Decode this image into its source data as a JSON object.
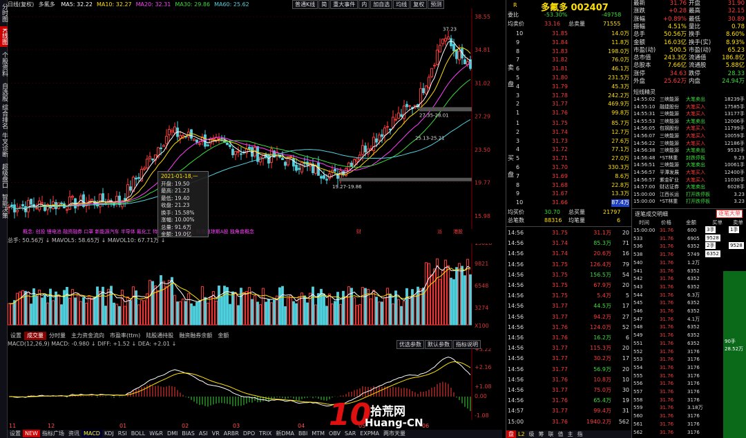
{
  "sidebar": [
    "分时图",
    "K线图",
    "个股资料",
    "自选股",
    "综合排名",
    "牛叉诊断",
    "超级盘口",
    "智能决策"
  ],
  "header": {
    "period": "日线(复权)",
    "stock_name": "多氟多",
    "ma": [
      {
        "label": "MA5: 32.22",
        "color": "#ffffff"
      },
      {
        "label": "MA10: 32.27",
        "color": "#ffe000"
      },
      {
        "label": "MA20: 32.31",
        "color": "#ff40ff"
      },
      {
        "label": "MA30: 29.86",
        "color": "#3cdc3c"
      },
      {
        "label": "MA60: 25.62",
        "color": "#4fd3e0"
      }
    ],
    "right_tools": [
      "普通K线",
      "简",
      "重大事件",
      "内",
      "加自选",
      "均线",
      "复权",
      "预测"
    ]
  },
  "price_axis": [
    "38.55",
    "34.81",
    "31.02",
    "27.29",
    "23.50",
    "19.77",
    "15.98"
  ],
  "annotations": {
    "high": "37.23",
    "range1": "27.35-28.01",
    "range2": "25.13-25.21",
    "low": "19.27-19.86"
  },
  "tooltip": {
    "date": "2021-01-18,一",
    "rows": [
      "开盘: 19.50",
      "最高: 21.23",
      "最低: 19.40",
      "收盘: 21.23",
      "换手: 15.58%",
      "涨幅: 10.00%",
      "总量: 91.6万",
      "金额: 19.0亿"
    ]
  },
  "concept_bar": "概念: 创投  锂电池  融资融券  口罩  新能源汽车  半导体  氟化工  特高压  稀土  氟化工  标普道琼斯A股  独角兽概念",
  "concept_marks": [
    "财",
    "派",
    "港股"
  ],
  "volume": {
    "legend": "总手: 50.56万 ↓  MAVOL5: 58.65万 ↓  MAVOL10: 67.71万 ↓",
    "axis": [
      "13028",
      "9821",
      "6548",
      "3274",
      "X100"
    ],
    "tabs": [
      "设置",
      "成交量",
      "分时量",
      "主力资金流向",
      "市盈率(ttm)",
      "陆股通持股",
      "融资融券余额",
      "金额"
    ],
    "active_tab": 1
  },
  "macd": {
    "legend": "MACD(12,26,9)  MACD: -0.980 ↓  DIFF: +1.52 ↓  DEA: +2.01 ↓",
    "buttons": [
      "优选参数",
      "默认参数",
      "指标说明"
    ],
    "axis": [
      "+3.22",
      "+2.16",
      "+1.08",
      "0.00",
      "-1.08"
    ]
  },
  "x_axis": [
    "11",
    "12",
    "01",
    "02",
    "03",
    "04",
    "05",
    "06"
  ],
  "bottom_tabs": [
    "设置",
    "NEW",
    "指标广场",
    "资讯",
    "MACD",
    "KDJ",
    "RSI",
    "BOLL",
    "W&R",
    "DMI",
    "BIAS",
    "ASI",
    "VR",
    "ARBR",
    "DPO",
    "TRIX",
    "新DMA",
    "BBI",
    "MTM",
    "OBV",
    "SAR",
    "EXPMA",
    "两市天量"
  ],
  "quote": {
    "tag": "R",
    "title": "多氟多 002407",
    "weibi_label": "委比",
    "weibi": "-53.30%",
    "weicha": "-49758",
    "avg_label": "均卖价",
    "avg_sell": "33.16",
    "total_sell_label": "总卖量",
    "total_sell": "71555",
    "sell_side": "卖盘",
    "buy_side": "买盘",
    "asks": [
      [
        "10",
        "31.85",
        "14.0万"
      ],
      [
        "9",
        "31.84",
        "11.8万"
      ],
      [
        "8",
        "31.83",
        "198.0万"
      ],
      [
        "7",
        "31.82",
        "76.0万"
      ],
      [
        "6",
        "31.81",
        "46.1万"
      ],
      [
        "5",
        "31.80",
        "231.5万"
      ],
      [
        "4",
        "31.79",
        "45.3万"
      ],
      [
        "3",
        "31.78",
        "242.2万"
      ],
      [
        "2",
        "31.77",
        "469.9万"
      ],
      [
        "1",
        "31.76",
        "99.8万"
      ]
    ],
    "bids": [
      [
        "1",
        "31.75",
        "85.7万"
      ],
      [
        "2",
        "31.74",
        "12.7万"
      ],
      [
        "3",
        "31.73",
        "27.6万"
      ],
      [
        "4",
        "31.72",
        "77.1万"
      ],
      [
        "5",
        "31.71",
        "27.0万"
      ],
      [
        "6",
        "31.70",
        "330.3万"
      ],
      [
        "7",
        "31.69",
        "8.6万"
      ],
      [
        "8",
        "31.68",
        "22.8万"
      ],
      [
        "9",
        "31.67",
        "13.3万"
      ],
      [
        "10",
        "31.66",
        "87.4万"
      ]
    ],
    "avg_buy_label": "均买价",
    "avg_buy": "30.70",
    "total_buy_label": "总买量",
    "total_buy": "21797",
    "total_trades_label": "总笔数",
    "total_trades": "88316",
    "avg_trade_label": "均笔量",
    "avg_trade": "6"
  },
  "trades": [
    [
      "14:56",
      "31.75",
      "31.1万",
      "20"
    ],
    [
      "14:56",
      "31.74",
      "85.3万",
      "71"
    ],
    [
      "14:56",
      "31.74",
      "20.6万",
      "16"
    ],
    [
      "14:56",
      "31.75",
      "126.4万",
      "79"
    ],
    [
      "14:56",
      "31.75",
      "156.5万",
      "54"
    ],
    [
      "14:56",
      "31.75",
      "67.9万",
      "20"
    ],
    [
      "14:56",
      "31.75",
      "5.4万",
      "5"
    ],
    [
      "14:56",
      "31.77",
      "44.5万",
      "17"
    ],
    [
      "14:56",
      "31.77",
      "94.2万",
      "27"
    ],
    [
      "14:56",
      "31.76",
      "124.0万",
      "52"
    ],
    [
      "14:56",
      "31.76",
      "16.2万",
      "6"
    ],
    [
      "14:56",
      "31.77",
      "115.3万",
      "20"
    ],
    [
      "14:56",
      "31.77",
      "30.2万",
      "17"
    ],
    [
      "14:56",
      "31.77",
      "56.9万",
      "20"
    ],
    [
      "14:56",
      "31.76",
      "10.8万",
      "10"
    ],
    [
      "14:56",
      "31.77",
      "75.0万",
      "30"
    ],
    [
      "14:56",
      "31.76",
      "65.4万",
      "19"
    ],
    [
      "14:57",
      "31.77",
      "99.4万",
      "31"
    ],
    [
      "15:00",
      "31.76",
      "1940.2万",
      "562"
    ]
  ],
  "trades_footer_tabs": [
    "盘",
    "L2",
    "级",
    "筹",
    "联",
    "值",
    "主",
    "指"
  ],
  "info": {
    "rows": [
      [
        [
          "最新",
          "31.76"
        ],
        [
          "开盘",
          "31.90"
        ]
      ],
      [
        [
          "涨跌",
          "+0.28"
        ],
        [
          "最高",
          "32.15"
        ]
      ],
      [
        [
          "涨幅",
          "+0.89%"
        ],
        [
          "最低",
          "30.89"
        ]
      ],
      [
        [
          "振幅",
          "4.51%"
        ],
        [
          "量比",
          "0.78"
        ]
      ],
      [
        [
          "总手",
          "50.56万"
        ],
        [
          "换手",
          "8.60%"
        ]
      ],
      [
        [
          "金额",
          "16.03亿"
        ],
        [
          "换手(实)",
          "8.93%"
        ]
      ],
      [
        [
          "市盈(动)",
          "500.5"
        ],
        [
          "市盈(动)",
          "65.23"
        ]
      ],
      [
        [
          "总市值",
          "243.3亿"
        ],
        [
          "流通值",
          "186.8亿"
        ]
      ],
      [
        [
          "总股本",
          "7.66亿"
        ],
        [
          "流通股",
          "5.88亿"
        ]
      ],
      [
        [
          "涨停",
          "34.63"
        ],
        [
          "跌停",
          "28.33"
        ]
      ],
      [
        [
          "外盘",
          "25.62万"
        ],
        [
          "内盘",
          "24.94万"
        ]
      ]
    ],
    "short_news_title": "短线精灵"
  },
  "news": [
    [
      "14:55:02",
      "三峡能源",
      "大笔卖出",
      "18239手"
    ],
    [
      "14:55:10",
      "融捷股份",
      "大笔买入",
      "17585手"
    ],
    [
      "14:55:31",
      "三峡能源",
      "大笔买入",
      "13177手"
    ],
    [
      "14:55:53",
      "三峡能源",
      "大笔卖出",
      "12006手"
    ],
    [
      "14:56:05",
      "包钢股份",
      "大笔买入",
      "11799手"
    ],
    [
      "14:56:07",
      "三峡能源",
      "大笔买入",
      "10059手"
    ],
    [
      "14:56:22",
      "三峡能源",
      "大笔买入",
      "12186手"
    ],
    [
      "14:56:38",
      "三峡能源",
      "大笔卖出",
      "9533手"
    ],
    [
      "14:56:48",
      "*ST林重",
      "封跌停板",
      "9.23"
    ],
    [
      "14:56:51",
      "三峡能源",
      "大笔卖出",
      "10061手"
    ],
    [
      "14:56:57",
      "平潭发展",
      "大笔买入",
      "12400手"
    ],
    [
      "14:56:57",
      "紫金矿业",
      "大笔买入",
      "11030手"
    ],
    [
      "14:57:00",
      "财达证券",
      "大笔卖出",
      "6028手"
    ],
    [
      "15:00:00",
      "江西长运",
      "打开跌停板",
      "3.23"
    ],
    [
      "15:00:00",
      "*ST林重",
      "打开跌停板",
      "3.23"
    ]
  ],
  "ticks_header": {
    "title": "逐笔成交明细",
    "badge": "逐笔大单",
    "cols": [
      "时间",
      "价格",
      "金额",
      "买单",
      "卖单"
    ]
  },
  "ticks": [
    [
      "15:00:00",
      "31.76",
      "600",
      "3手",
      "1手"
    ],
    [
      "533",
      "31.76",
      "6905",
      "9528",
      ""
    ],
    [
      "536",
      "31.76",
      "6352",
      "2手",
      "9528"
    ],
    [
      "538",
      "31.76",
      "5749",
      "6352",
      ""
    ],
    [
      "540",
      "31.76",
      "1.2万",
      "",
      ""
    ],
    [
      "541",
      "31.76",
      "6352",
      "",
      ""
    ],
    [
      "542",
      "31.76",
      "6352",
      "",
      ""
    ],
    [
      "543",
      "31.76",
      "6352",
      "",
      ""
    ],
    [
      "544",
      "31.76",
      "6.3万",
      "",
      ""
    ],
    [
      "545",
      "31.76",
      "6352",
      "",
      ""
    ],
    [
      "546",
      "31.76",
      "6352",
      "",
      ""
    ],
    [
      "547",
      "31.76",
      "4.1万",
      "",
      ""
    ],
    [
      "548",
      "31.76",
      "6352",
      "",
      ""
    ],
    [
      "549",
      "31.76",
      "6352",
      "",
      ""
    ],
    [
      "551",
      "31.76",
      "6352",
      "",
      ""
    ],
    [
      "552",
      "31.76",
      "3176",
      "",
      ""
    ],
    [
      "553",
      "31.76",
      "3176",
      "",
      ""
    ],
    [
      "554",
      "31.76",
      "3176",
      "",
      ""
    ],
    [
      "555",
      "31.76",
      "3176",
      "",
      ""
    ],
    [
      "556",
      "31.76",
      "3176",
      "",
      ""
    ],
    [
      "557",
      "31.76",
      "3176",
      "",
      ""
    ],
    [
      "558",
      "31.76",
      "3176",
      "",
      ""
    ],
    [
      "559",
      "31.76",
      "3.18万",
      "",
      ""
    ],
    [
      "560",
      "31.76",
      "3176",
      "",
      ""
    ],
    [
      "561",
      "31.76",
      "3176",
      "",
      ""
    ],
    [
      "562",
      "31.76",
      "3176",
      "",
      ""
    ]
  ],
  "ticks_side": {
    "label": "90手",
    "amount": "28.52万"
  },
  "watermark": {
    "big": "10",
    "site": "拾荒网",
    "url": "Huang-CN"
  }
}
